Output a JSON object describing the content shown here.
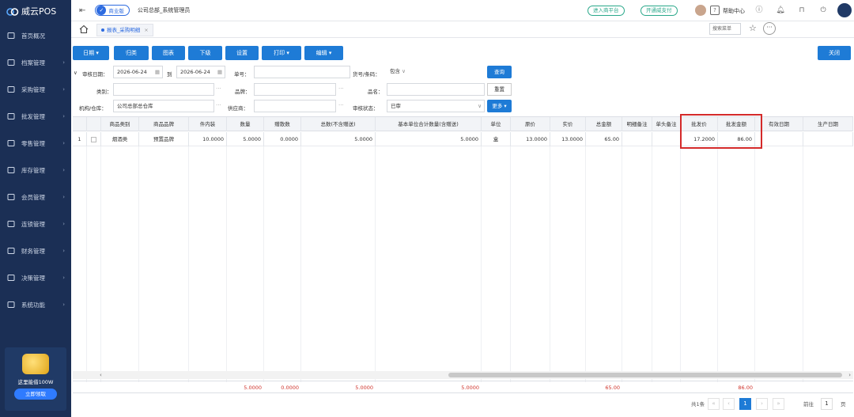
{
  "app": {
    "name": "威云POS"
  },
  "sidebar": {
    "items": [
      {
        "label": "首页概况",
        "icon": "home-dashboard-icon",
        "chevron": false
      },
      {
        "label": "档案管理",
        "icon": "archive-icon",
        "chevron": true
      },
      {
        "label": "采购管理",
        "icon": "cart-icon",
        "chevron": true
      },
      {
        "label": "批发管理",
        "icon": "truck-icon",
        "chevron": true
      },
      {
        "label": "零售管理",
        "icon": "card-icon",
        "chevron": true
      },
      {
        "label": "库存管理",
        "icon": "box-icon",
        "chevron": true
      },
      {
        "label": "会员管理",
        "icon": "member-icon",
        "chevron": true
      },
      {
        "label": "连锁管理",
        "icon": "chain-icon",
        "chevron": true
      },
      {
        "label": "财务管理",
        "icon": "finance-icon",
        "chevron": true
      },
      {
        "label": "决策管理",
        "icon": "chart-icon",
        "chevron": true
      },
      {
        "label": "系统功能",
        "icon": "settings-icon",
        "chevron": true
      }
    ],
    "promo": {
      "text": "这里能借100W",
      "button": "立即领取"
    }
  },
  "header": {
    "edition": "商业版",
    "user_org": "公司总部_系统管理员",
    "btn_platform": "进入商平台",
    "btn_pay": "开通威支付",
    "help": "帮助中心"
  },
  "tabs": {
    "active": "报表_采购明细",
    "menu_search": "搜索菜单"
  },
  "toolbar": {
    "date": "日期",
    "classify": "归类",
    "chart": "图表",
    "subordinate": "下级",
    "settings": "设置",
    "print": "打印",
    "edit": "编辑",
    "close": "关闭"
  },
  "filters": {
    "audit_date_label": "审核日期：",
    "date_from": "2026-06-24",
    "to_label": "到",
    "date_to": "2026-06-24",
    "order_no_label": "单号：",
    "order_no": "",
    "code_label": "货号/条码：",
    "code_mode": "包含",
    "code_value": "",
    "query": "查询",
    "category_label": "类别：",
    "brand_label": "品牌：",
    "name_label": "品名：",
    "reset": "重置",
    "org_label": "机构/仓库：",
    "org_value": "公司总部总仓库",
    "supplier_label": "供应商：",
    "status_label": "审核状态：",
    "status_value": "已审",
    "more": "更多"
  },
  "table": {
    "columns": [
      "商品类别",
      "商品品牌",
      "件内装",
      "数量",
      "赠散数",
      "总数(不含赠送)",
      "基本单位合计数量(含赠送)",
      "单位",
      "原价",
      "实价",
      "总金额",
      "明细备注",
      "单头备注",
      "批发价",
      "批发金额",
      "有效日期",
      "生产日期"
    ],
    "rows": [
      {
        "idx": "1",
        "category": "烟酒类",
        "brand": "预置品牌",
        "per_pack": "10.0000",
        "qty": "5.0000",
        "gift": "0.0000",
        "total": "5.0000",
        "base_total": "5.0000",
        "unit": "盒",
        "orig_price": "13.0000",
        "real_price": "13.0000",
        "amount": "65.00",
        "detail_note": "",
        "head_note": "",
        "wholesale_price": "17.2000",
        "wholesale_amount": "86.00",
        "valid_date": "",
        "prod_date": ""
      }
    ],
    "totals": {
      "qty": "5.0000",
      "gift": "0.0000",
      "total": "5.0000",
      "base_total": "5.0000",
      "amount": "65.00",
      "wholesale_amount": "86.00"
    }
  },
  "pager": {
    "total": "共1条",
    "current": "1",
    "goto_label": "前往",
    "goto_value": "1",
    "page_suffix": "页"
  },
  "colors": {
    "sidebar": "#1b2f55",
    "primary": "#1e7bd6",
    "highlight": "#d42a2a",
    "total_text": "#d0342c"
  }
}
